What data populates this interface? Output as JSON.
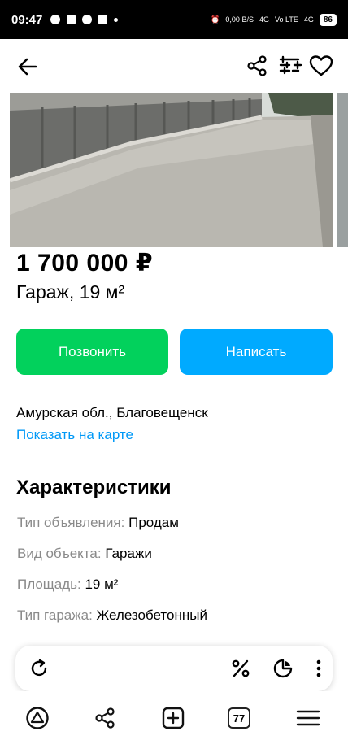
{
  "status_bar": {
    "time": "09:47",
    "speed_value": "0,00",
    "speed_unit": "B/S",
    "net1": "4G",
    "volte": "Vo LTE",
    "net2": "4G",
    "battery": "86"
  },
  "listing": {
    "price": "1 700 000 ₽",
    "title": "Гараж, 19 м²",
    "call_label": "Позвонить",
    "write_label": "Написать",
    "location": "Амурская обл., Благовещенск",
    "map_link": "Показать на карте"
  },
  "characteristics": {
    "title": "Характеристики",
    "rows": [
      {
        "key": "Тип объявления:",
        "value": "Продам"
      },
      {
        "key": "Вид объекта:",
        "value": "Гаражи"
      },
      {
        "key": "Площадь:",
        "value": "19 м²"
      },
      {
        "key": "Тип гаража:",
        "value": "Железобетонный"
      }
    ]
  },
  "browser": {
    "tabs_count": "77"
  },
  "colors": {
    "call_button": "#02d15c",
    "write_button": "#00aaff",
    "link": "#0099f7",
    "label_gray": "#8a8a8a"
  },
  "icons": [
    "back-arrow-icon",
    "share-icon",
    "compare-icon",
    "heart-icon",
    "refresh-icon",
    "percent-icon",
    "pie-icon",
    "more-vertical-icon",
    "home-icon",
    "share-icon",
    "new-tab-icon",
    "tabs-icon",
    "menu-icon"
  ]
}
